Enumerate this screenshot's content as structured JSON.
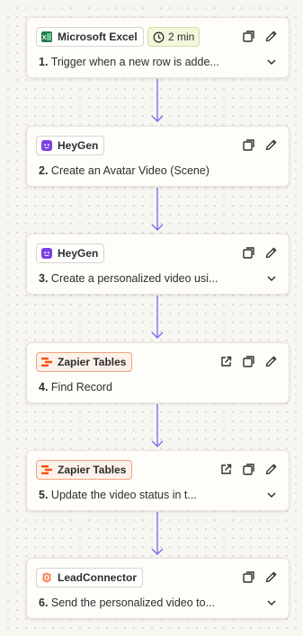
{
  "colors": {
    "connector": "#7d6df2",
    "heygen": "#7b3fe4",
    "excel": "#1f7a45",
    "zapier": "#ff4f00",
    "leadconnector": "#f06a35"
  },
  "steps": [
    {
      "number": "1.",
      "title": "Trigger when a new row is adde...",
      "app": "Microsoft Excel",
      "app_icon": "excel-icon",
      "time_badge": "2 min"
    },
    {
      "number": "2.",
      "title": "Create an Avatar Video (Scene)",
      "app": "HeyGen",
      "app_icon": "heygen-icon"
    },
    {
      "number": "3.",
      "title": "Create a personalized video usi...",
      "app": "HeyGen",
      "app_icon": "heygen-icon"
    },
    {
      "number": "4.",
      "title": "Find Record",
      "app": "Zapier Tables",
      "app_icon": "zapier-tables-icon"
    },
    {
      "number": "5.",
      "title": "Update the video status in t...",
      "app": "Zapier Tables",
      "app_icon": "zapier-tables-icon"
    },
    {
      "number": "6.",
      "title": "Send the personalized video to...",
      "app": "LeadConnector",
      "app_icon": "leadconnector-icon"
    }
  ]
}
